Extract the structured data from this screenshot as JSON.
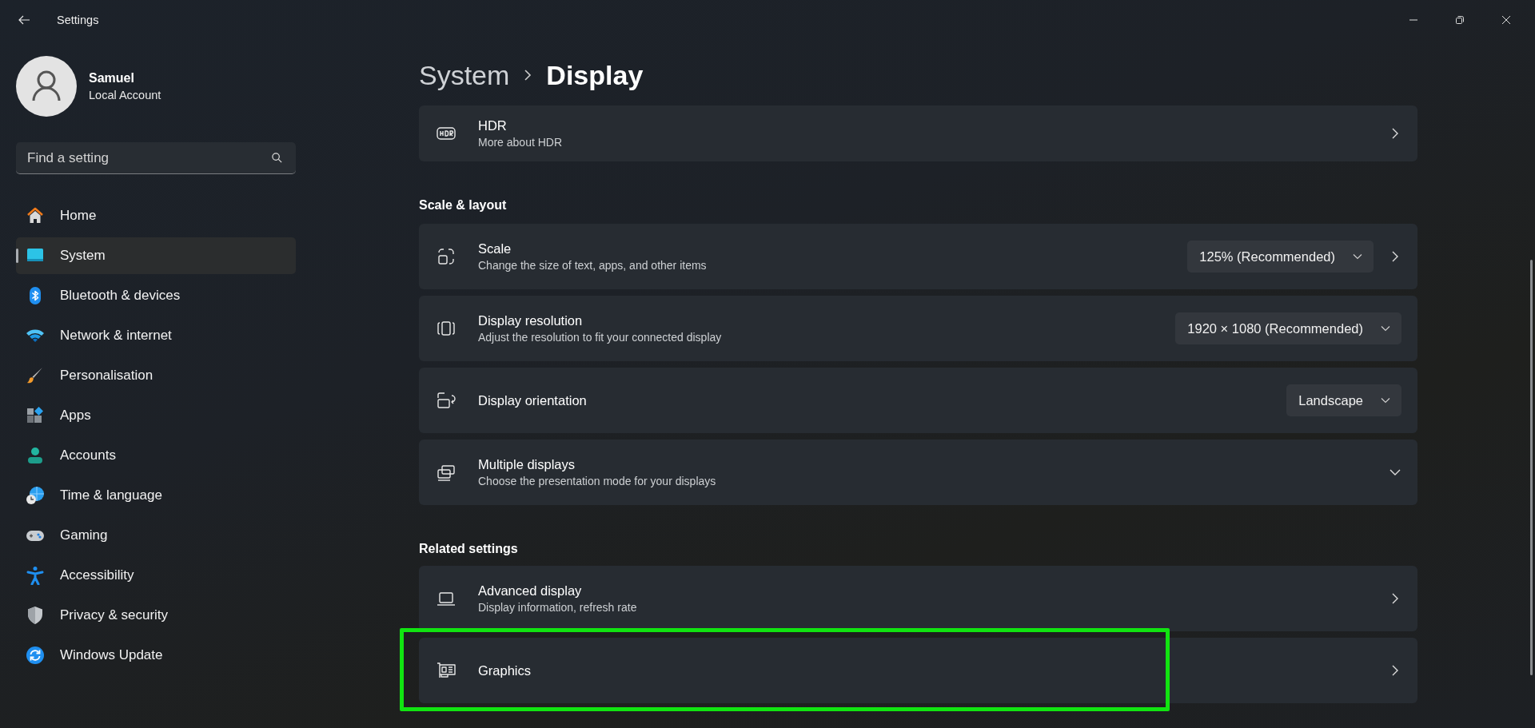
{
  "window": {
    "title": "Settings"
  },
  "profile": {
    "name": "Samuel",
    "account": "Local Account"
  },
  "search": {
    "placeholder": "Find a setting"
  },
  "nav": [
    {
      "label": "Home",
      "selected": false
    },
    {
      "label": "System",
      "selected": true
    },
    {
      "label": "Bluetooth & devices",
      "selected": false
    },
    {
      "label": "Network & internet",
      "selected": false
    },
    {
      "label": "Personalisation",
      "selected": false
    },
    {
      "label": "Apps",
      "selected": false
    },
    {
      "label": "Accounts",
      "selected": false
    },
    {
      "label": "Time & language",
      "selected": false
    },
    {
      "label": "Gaming",
      "selected": false
    },
    {
      "label": "Accessibility",
      "selected": false
    },
    {
      "label": "Privacy & security",
      "selected": false
    },
    {
      "label": "Windows Update",
      "selected": false
    }
  ],
  "breadcrumb": [
    "System",
    "Display"
  ],
  "sections": [
    {
      "cards": [
        {
          "title": "HDR",
          "subtitle": "More about HDR",
          "kind": "link",
          "highlighted": false
        }
      ]
    },
    {
      "heading": "Scale & layout",
      "cards": [
        {
          "title": "Scale",
          "subtitle": "Change the size of text, apps, and other items",
          "dropdown": "125% (Recommended)",
          "kind": "link",
          "highlighted": false
        },
        {
          "title": "Display resolution",
          "subtitle": "Adjust the resolution to fit your connected display",
          "dropdown": "1920 × 1080 (Recommended)",
          "kind": "select",
          "highlighted": false
        },
        {
          "title": "Display orientation",
          "dropdown": "Landscape",
          "kind": "select",
          "highlighted": false
        },
        {
          "title": "Multiple displays",
          "subtitle": "Choose the presentation mode for your displays",
          "kind": "expander",
          "highlighted": false
        }
      ]
    },
    {
      "heading": "Related settings",
      "cards": [
        {
          "title": "Advanced display",
          "subtitle": "Display information, refresh rate",
          "kind": "link",
          "highlighted": false
        },
        {
          "title": "Graphics",
          "kind": "link",
          "highlighted": true
        }
      ]
    }
  ]
}
